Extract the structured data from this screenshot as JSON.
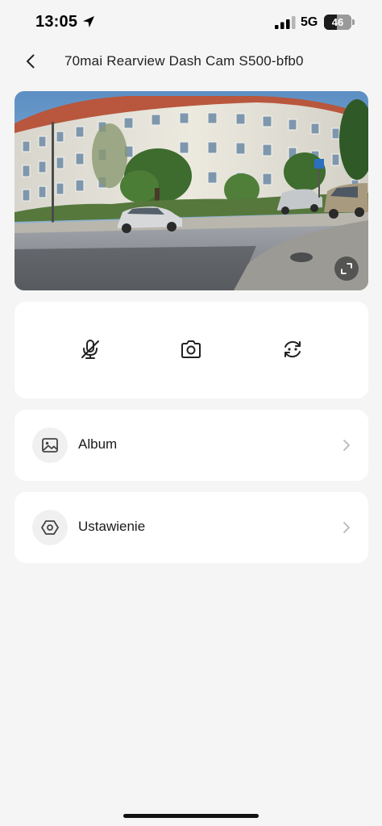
{
  "status_bar": {
    "time": "13:05",
    "network": "5G",
    "battery": "46",
    "battery_level_percent": 46
  },
  "header": {
    "title": "70mai Rearview Dash Cam S500-bfb0",
    "back_icon": "chevron-left-icon"
  },
  "preview": {
    "fullscreen_icon": "expand-icon"
  },
  "controls": {
    "mic_icon": "mic-muted-icon",
    "camera_icon": "camera-icon",
    "switch_icon": "switch-camera-icon"
  },
  "menu": [
    {
      "label": "Album",
      "icon": "image-icon"
    },
    {
      "label": "Ustawienie",
      "icon": "settings-hexagon-icon"
    }
  ],
  "colors": {
    "background": "#f5f5f5",
    "card": "#ffffff",
    "icon_circle": "#f0f0f0",
    "text": "#222222",
    "chevron": "#b8b8b8"
  }
}
